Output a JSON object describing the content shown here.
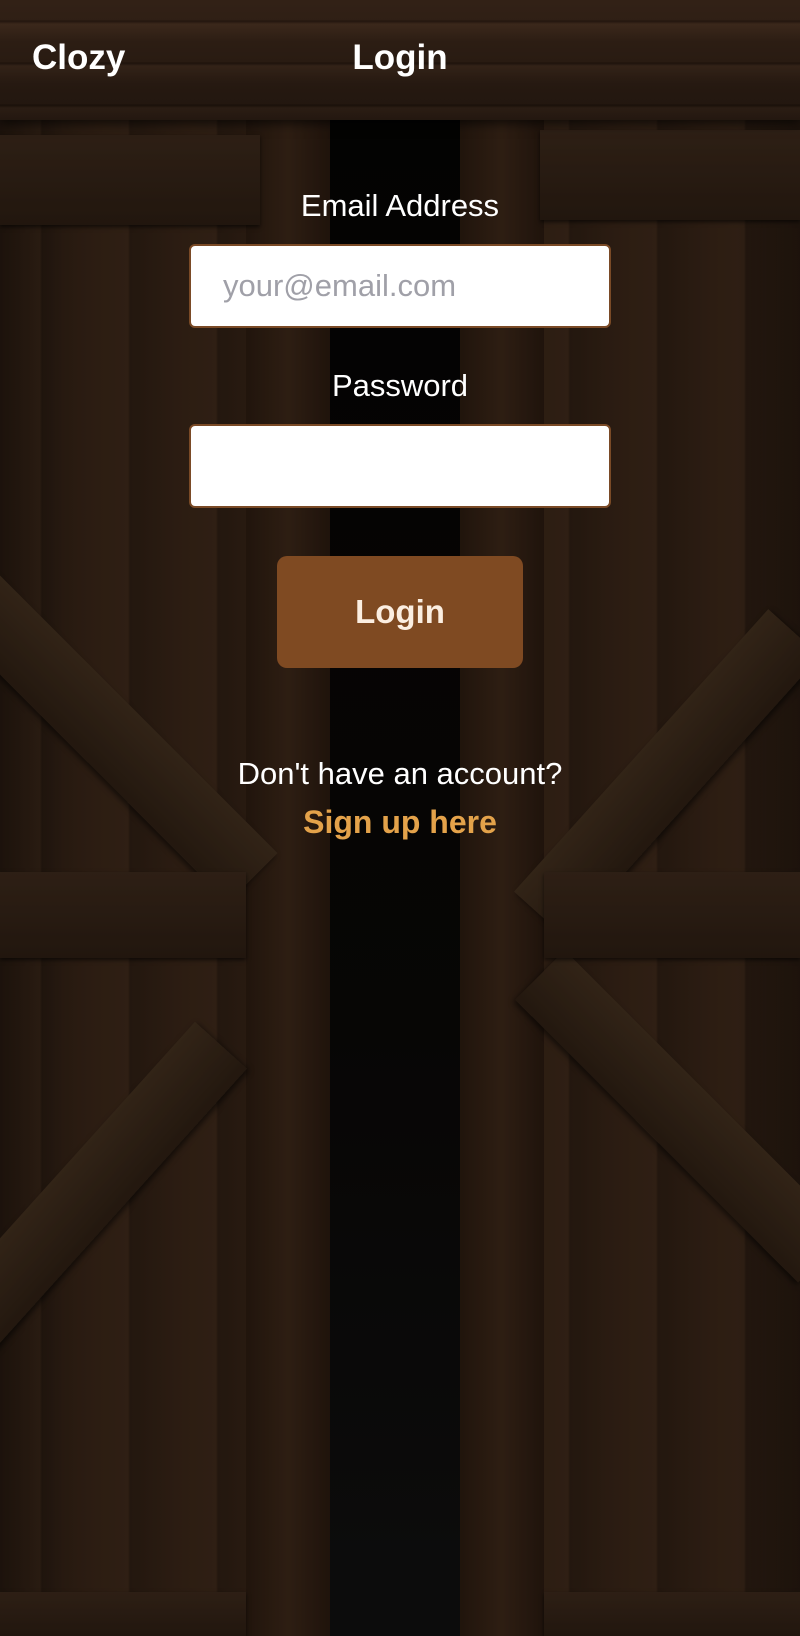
{
  "header": {
    "brand": "Clozy",
    "title": "Login"
  },
  "form": {
    "email_label": "Email Address",
    "email_placeholder": "your@email.com",
    "email_value": "",
    "password_label": "Password",
    "password_value": "",
    "login_button_label": "Login"
  },
  "signup": {
    "prompt": "Don't have an account?",
    "link_label": "Sign up here"
  },
  "colors": {
    "button_background": "#7f4a22",
    "link_color": "#e3a24a",
    "header_background": "#3b271a"
  }
}
